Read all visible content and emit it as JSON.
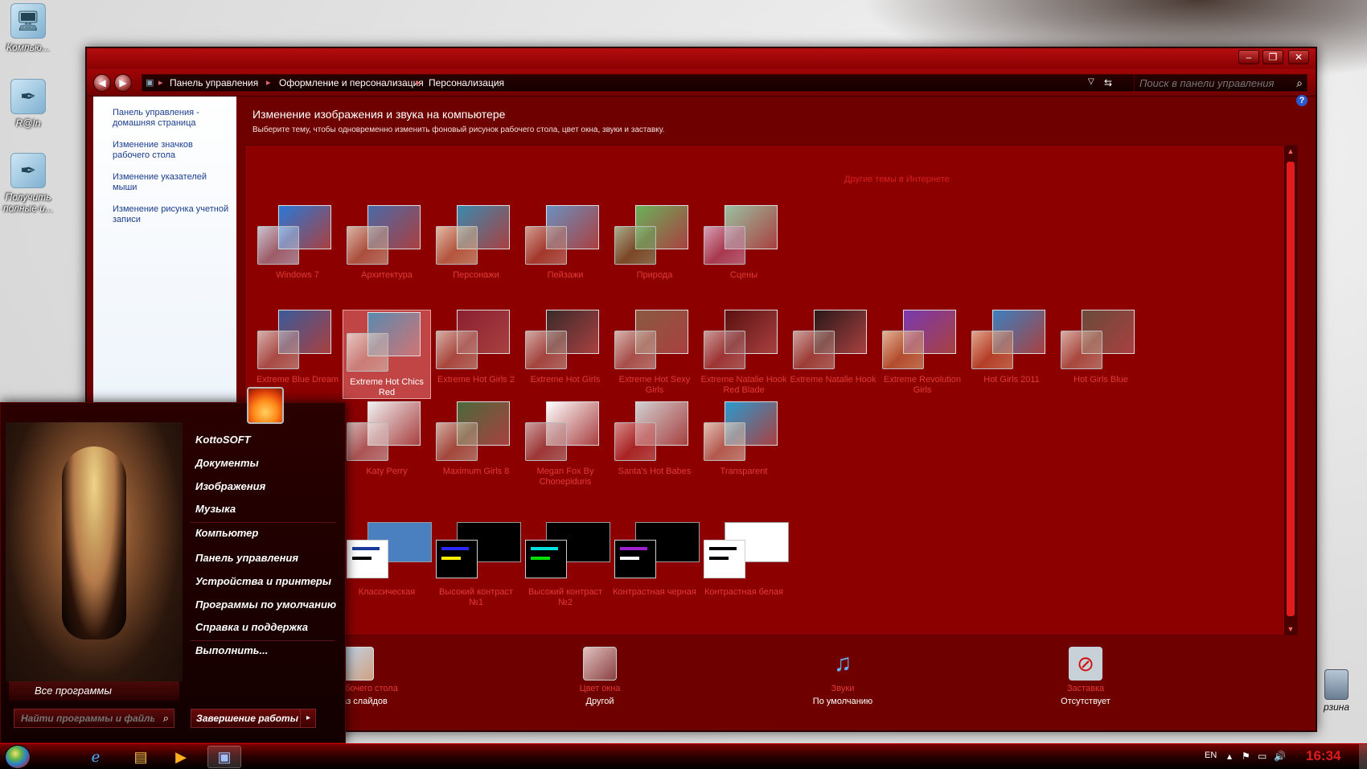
{
  "desktop": {
    "icons": [
      {
        "label": "Компью...",
        "icon": "computer-icon"
      },
      {
        "label": "R@In",
        "icon": "feather-icon"
      },
      {
        "label": "Получить полные и...",
        "icon": "feather-icon"
      }
    ],
    "trash_label": "рзина"
  },
  "window": {
    "nav": {
      "breadcrumbs": [
        "Панель управления",
        "Оформление и персонализация",
        "Персонализация"
      ],
      "search_placeholder": "Поиск в панели управления"
    },
    "left_pane": {
      "home": "Панель управления - домашняя страница",
      "links": [
        "Изменение значков рабочего стола",
        "Изменение указателей мыши",
        "Изменение рисунка учетной записи"
      ]
    },
    "heading": "Изменение изображения и звука на компьютере",
    "subheading": "Выберите тему, чтобы одновременно изменить фоновый рисунок рабочего стола, цвет окна, звуки и заставку.",
    "online_themes_link": "Другие темы в Интернете",
    "themes_row1": [
      {
        "name": "Windows 7",
        "back": "#2a78d6",
        "front": "#9fcaf0"
      },
      {
        "name": "Архитектура",
        "back": "#4a6aa8",
        "front": "#c8a070"
      },
      {
        "name": "Персонажи",
        "back": "#3a8ab0",
        "front": "#e0b070"
      },
      {
        "name": "Пейзажи",
        "back": "#6a90c0",
        "front": "#b05a3a"
      },
      {
        "name": "Природа",
        "back": "#6ab05a",
        "front": "#3a8a2a"
      },
      {
        "name": "Сцены",
        "back": "#9ac0a0",
        "front": "#c060a0"
      }
    ],
    "themes_row2": [
      {
        "name": "Extreme Blue Dream",
        "back": "#3a5a9a",
        "front": "#c09080"
      },
      {
        "name": "Extreme Hot Chics Red",
        "back": "#5a8ab0",
        "front": "#d0b0a0",
        "selected": true
      },
      {
        "name": "Extreme Hot Girls 2",
        "back": "#8a2030",
        "front": "#c08a70"
      },
      {
        "name": "Extreme Hot Girls",
        "back": "#3a2a2a",
        "front": "#b08070"
      },
      {
        "name": "Extreme Hot Sexy Girls",
        "back": "#8a5a40",
        "front": "#c0a090"
      },
      {
        "name": "Extreme Natalie Hook Red Blade",
        "back": "#5a1010",
        "front": "#a05050"
      },
      {
        "name": "Extreme Natalie Hook",
        "back": "#2a1818",
        "front": "#a06a5a"
      },
      {
        "name": "Extreme Revolution Girls",
        "back": "#7a3ab0",
        "front": "#e09a40"
      },
      {
        "name": "Hot Girls 2011",
        "back": "#3a80c0",
        "front": "#e0702a"
      },
      {
        "name": "Hot Girls Blue",
        "back": "#6a4a3a",
        "front": "#c08a70"
      }
    ],
    "themes_row3": [
      {
        "name": "Katy Perry",
        "back": "#f0f0f0",
        "front": "#d0b0b0"
      },
      {
        "name": "Maximum Girls 8",
        "back": "#4a6a3a",
        "front": "#b08a6a"
      },
      {
        "name": "Megan Fox By Chonepiduris",
        "back": "#ffffff",
        "front": "#a05a5a"
      },
      {
        "name": "Santa's Hot Babes",
        "back": "#d0d0d0",
        "front": "#c02020"
      },
      {
        "name": "Transparent",
        "back": "#2a9ad0",
        "front": "#e0c0a0"
      }
    ],
    "contrast_themes": [
      {
        "name": "Классическая",
        "back": "#4a80c0",
        "front": "#ffffff",
        "bars": [
          "#1a3a9a",
          "#000000"
        ]
      },
      {
        "name": "Высокий контраст №1",
        "back": "#000000",
        "front": "#000000",
        "bars": [
          "#2a2aff",
          "#ffee00"
        ]
      },
      {
        "name": "Высокий контраст №2",
        "back": "#000000",
        "front": "#000000",
        "bars": [
          "#00e0e0",
          "#00e000"
        ]
      },
      {
        "name": "Контрастная черная",
        "back": "#000000",
        "front": "#000000",
        "bars": [
          "#a020d0",
          "#ffffff"
        ]
      },
      {
        "name": "Контрастная белая",
        "back": "#ffffff",
        "front": "#ffffff",
        "bars": [
          "#000000",
          "#000000"
        ]
      }
    ],
    "tools": [
      {
        "name": "Фон рабочего стола",
        "value": "Показ слайдов",
        "icon": "desktop-background-icon"
      },
      {
        "name": "Цвет окна",
        "value": "Другой",
        "icon": "window-color-icon"
      },
      {
        "name": "Звуки",
        "value": "По умолчанию",
        "icon": "sounds-icon"
      },
      {
        "name": "Заставка",
        "value": "Отсутствует",
        "icon": "screensaver-icon"
      }
    ]
  },
  "start_menu": {
    "all_programs": "Все программы",
    "search_placeholder": "Найти программы и файлы",
    "items": [
      "KottoSOFT",
      "Документы",
      "Изображения",
      "Музыка",
      "Компьютер",
      "Панель управления",
      "Устройства и принтеры",
      "Программы по умолчанию",
      "Справка и поддержка",
      "Выполнить..."
    ],
    "shutdown": "Завершение работы"
  },
  "taskbar": {
    "lang": "EN",
    "time": "16:34",
    "pinned": [
      {
        "icon": "internet-explorer-icon"
      },
      {
        "icon": "explorer-folder-icon"
      },
      {
        "icon": "media-player-icon"
      },
      {
        "icon": "control-panel-icon"
      }
    ]
  },
  "colors": {
    "window_bg": "#6e0000",
    "panel_bg": "#8c0000",
    "accent_red": "#e01c1c",
    "link_blue": "#1a3e8c"
  }
}
